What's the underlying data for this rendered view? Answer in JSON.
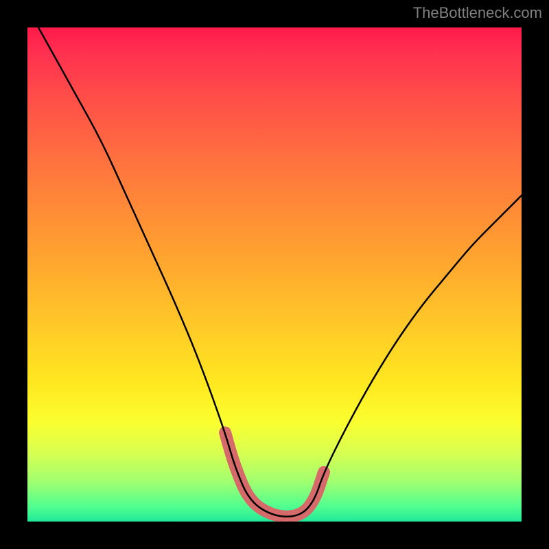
{
  "chart_data": {
    "type": "line",
    "title": "",
    "xlabel": "",
    "ylabel": "",
    "xlim": [
      0,
      100
    ],
    "ylim": [
      0,
      100
    ],
    "series": [
      {
        "name": "bottleneck-curve",
        "x": [
          0,
          5,
          10,
          15,
          20,
          25,
          30,
          35,
          40,
          42,
          45,
          50,
          55,
          58,
          60,
          65,
          70,
          75,
          80,
          85,
          90,
          95,
          100
        ],
        "values": [
          104,
          95,
          86,
          77,
          66,
          55,
          44,
          32,
          18,
          11,
          4,
          1,
          1,
          4,
          10,
          20,
          29,
          37,
          44,
          50,
          56,
          61,
          66
        ]
      },
      {
        "name": "highlight-band",
        "x": [
          40,
          42,
          45,
          50,
          55,
          58,
          60
        ],
        "values": [
          18,
          11,
          4,
          1,
          1,
          4,
          10
        ]
      }
    ],
    "gradient_colors": {
      "top": "#ff1a4a",
      "mid_upper": "#ffa030",
      "mid_lower": "#ffe820",
      "bottom": "#20e898"
    }
  },
  "watermark": "TheBottleneck.com"
}
